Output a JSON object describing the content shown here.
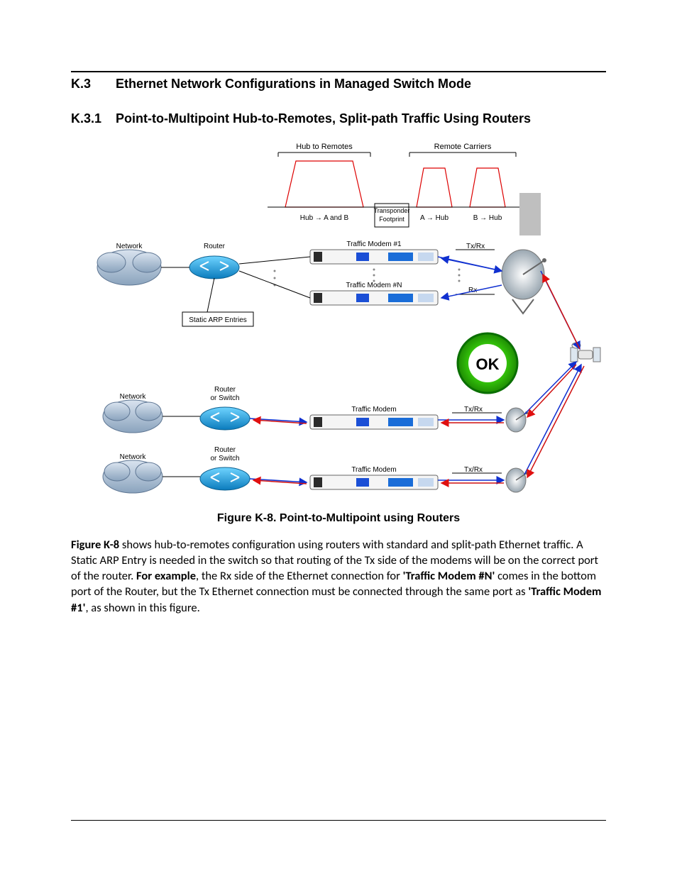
{
  "headings": {
    "main_num": "K.3",
    "main_title": "Ethernet Network Configurations in Managed Switch Mode",
    "sub_num": "K.3.1",
    "sub_title": "Point-to-Multipoint Hub-to-Remotes, Split-path Traffic Using Routers"
  },
  "figure": {
    "labels": {
      "hub_to_remotes": "Hub to Remotes",
      "remote_carriers": "Remote Carriers",
      "hub_ab": "Hub → A and B",
      "transponder": "Transponder",
      "footprint": "Footprint",
      "a_hub": "A → Hub",
      "b_hub": "B → Hub",
      "network": "Network",
      "router": "Router",
      "router_or_switch_a": "Router",
      "router_or_switch_b": "or Switch",
      "traffic_modem_1": "Traffic Modem #1",
      "traffic_modem_n": "Traffic Modem #N",
      "traffic_modem": "Traffic Modem",
      "txrx": "Tx/Rx",
      "rx": "Rx",
      "static_arp": "Static ARP Entries",
      "ok": "OK"
    }
  },
  "caption": "Figure K-8. Point-to-Multipoint using Routers",
  "paragraph": {
    "lead_bold": "Figure K-8",
    "t1": " shows hub-to-remotes configuration using routers with standard and split-path Ethernet traffic. A Static ARP Entry is needed in the switch so that routing of the Tx side of the modems will be on the correct port of the router. ",
    "for_example": "For example",
    "t2": ", the Rx side of the Ethernet connection for ",
    "modem_n": "'Traffic Modem #N'",
    "t3": " comes in the bottom port of the Router, but the Tx Ethernet connection must be connected through the same port as ",
    "modem_1": "'Traffic Modem #1'",
    "t4": ", as shown in this figure."
  }
}
